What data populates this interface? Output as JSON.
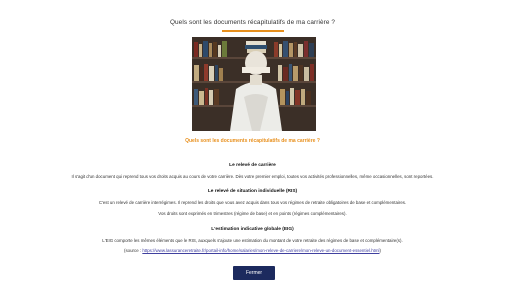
{
  "dialog": {
    "title": "Quels sont les documents récapitulatifs de ma carrière ?",
    "image_caption": "Quels sont les documents récapitulatifs de ma carrière ?",
    "sections": [
      {
        "heading": "Le relevé de carrière",
        "lines": [
          "Il s'agit d'un document qui reprend tous vos droits acquis au cours de votre carrière. Dès votre premier emploi, toutes vos activités professionnelles, même occasionnelles, sont reportées."
        ]
      },
      {
        "heading": "Le relevé de situation individuelle (RIS)",
        "lines": [
          "C'est un relevé de carrière interrégimes. Il reprend les droits que vous avez acquis dans tous vos régimes de retraite obligatoires de base et complémentaires.",
          "Vos droits sont exprimés en trimestres (régime de base) et en points (régimes complémentaires)."
        ]
      },
      {
        "heading": "L'estimation indicative globale (EIG)",
        "lines": [
          "L'EIG comporte les mêmes éléments que le RIS, auxquels s'ajoute une estimation du montant de votre retraite des régimes de base et complémentaire(s)."
        ]
      }
    ],
    "source_prefix": "(source : ",
    "source_link": "https://www.lassuranceretraite.fr/portail-info/home/salaries/mon-releve-de-carriere/mon-releve-un-document-essentiel.html",
    "source_suffix": ")",
    "close_label": "Fermer"
  },
  "colors": {
    "accent": "#e8901e",
    "button": "#1c2a5e",
    "link": "#4040a0"
  }
}
